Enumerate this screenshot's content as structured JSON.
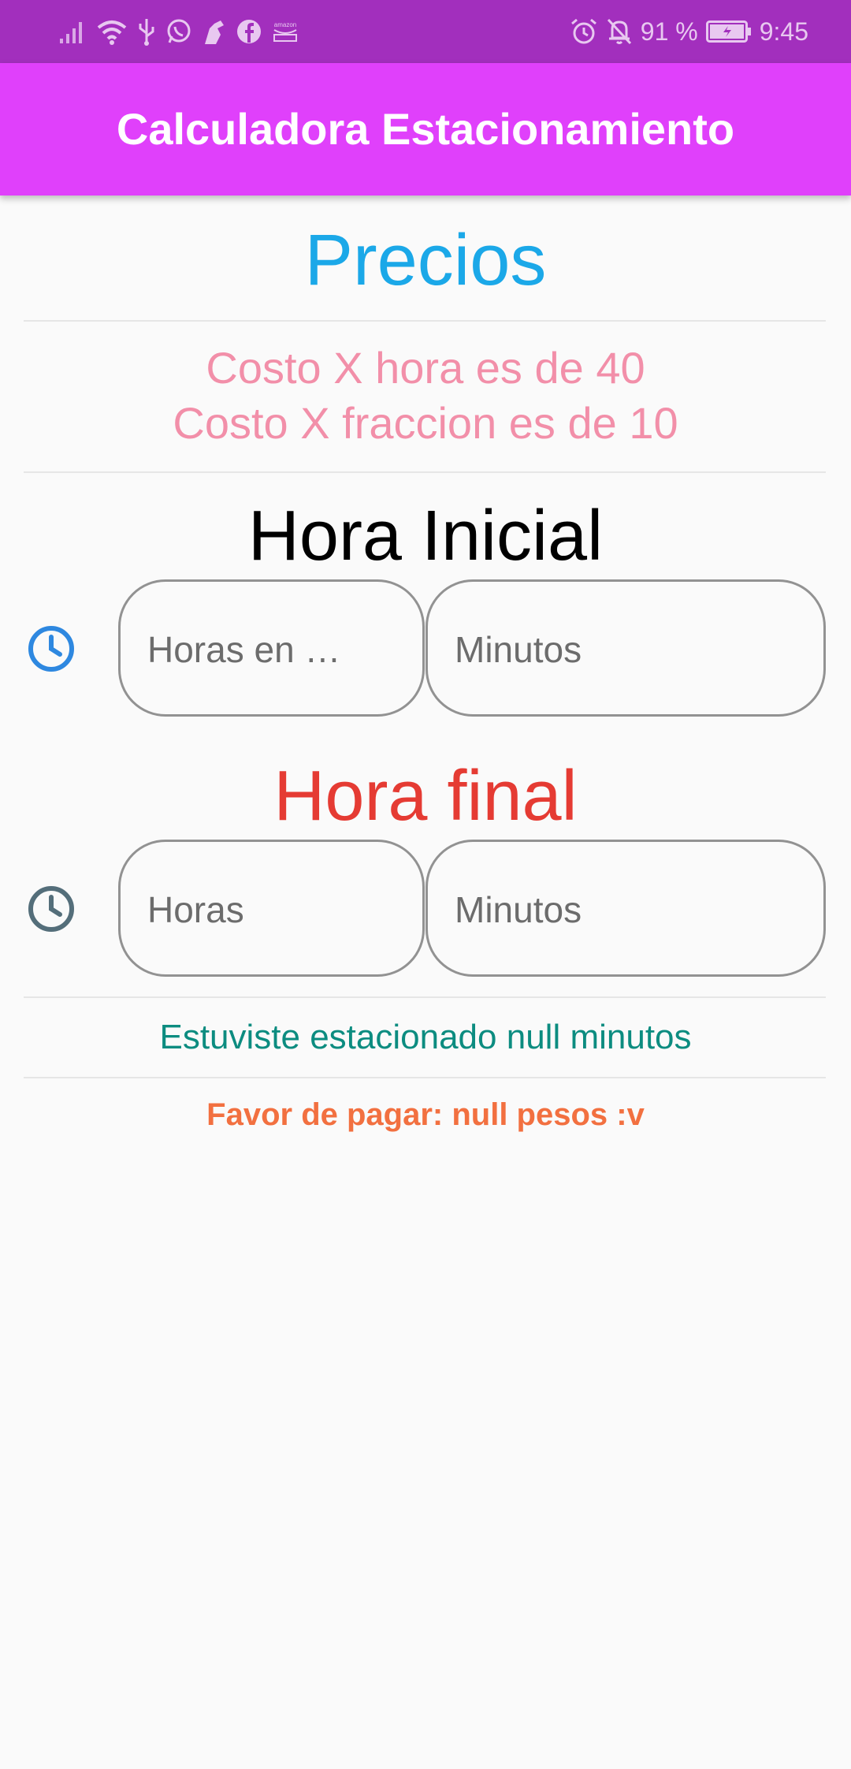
{
  "status_bar": {
    "battery_percent": "91 %",
    "time": "9:45",
    "icons": [
      "signal-icon",
      "wifi-icon",
      "usb-icon",
      "whatsapp-icon",
      "app-notification-icon",
      "facebook-icon",
      "amazon-icon",
      "alarm-icon",
      "mute-icon",
      "battery-charging-icon"
    ]
  },
  "app_bar": {
    "title": "Calculadora Estacionamiento",
    "color": "#e040fb"
  },
  "prices": {
    "title": "Precios",
    "hour_cost": "Costo X hora es de 40",
    "fraction_cost": "Costo X fraccion es de 10"
  },
  "initial_time": {
    "title": "Hora Inicial",
    "icon": "clock-icon",
    "icon_color": "#2e88e0",
    "hours_placeholder": "Horas en …",
    "minutes_placeholder": "Minutos"
  },
  "final_time": {
    "title": "Hora final",
    "icon": "clock-icon",
    "icon_color": "#546e7a",
    "hours_placeholder": "Horas",
    "minutes_placeholder": "Minutos"
  },
  "result": {
    "parked_text": "Estuviste estacionado null minutos",
    "pay_text": "Favor de pagar: null pesos :v"
  }
}
